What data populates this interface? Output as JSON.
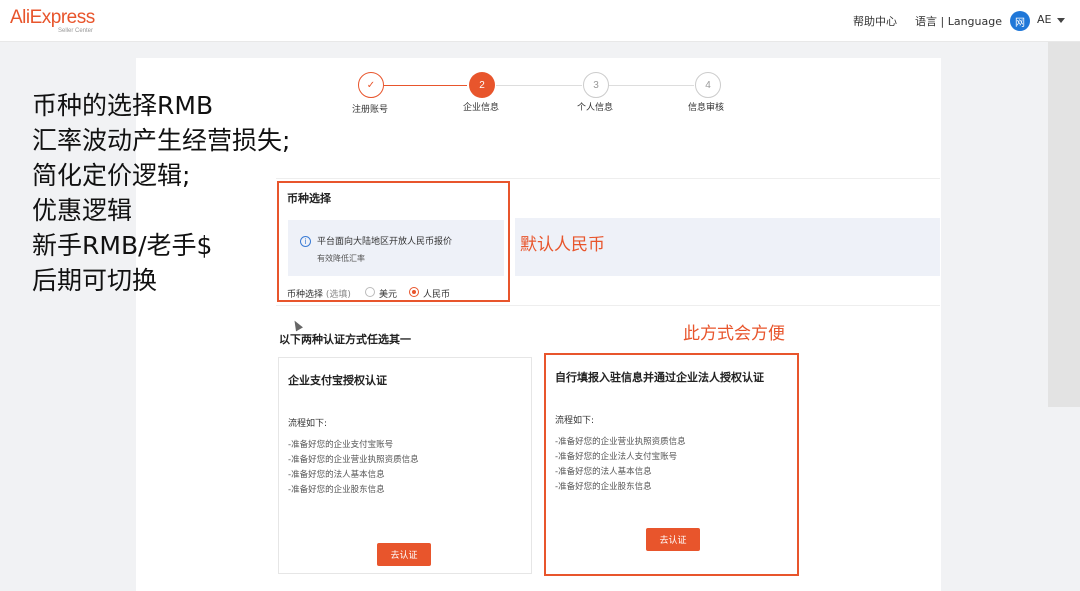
{
  "header": {
    "logo_main": "AliExpress",
    "logo_sub": "Seller Center",
    "help_link": "帮助中心",
    "language_link": "语言 | Language",
    "avatar_text": "网",
    "user_name": "AE"
  },
  "notes": {
    "lines": [
      "币种的选择RMB",
      "汇率波动产生经营损失;",
      "简化定价逻辑;",
      "优惠逻辑",
      "新手RMB/老手$",
      "后期可切换"
    ]
  },
  "steps": [
    {
      "number": "✓",
      "label": "注册账号",
      "state": "done"
    },
    {
      "number": "2",
      "label": "企业信息",
      "state": "active"
    },
    {
      "number": "3",
      "label": "个人信息",
      "state": "todo"
    },
    {
      "number": "4",
      "label": "信息审核",
      "state": "todo"
    }
  ],
  "currency": {
    "title": "币种选择",
    "notice_line1": "平台面向大陆地区开放人民币报价",
    "notice_line2": "有效降低汇率",
    "field_label": "币种选择",
    "field_hint": "(选填)",
    "options": [
      "美元",
      "人民币"
    ],
    "selected": "人民币"
  },
  "annotations": {
    "default_rmb": "默认人民币",
    "convenient": "此方式会方便"
  },
  "auth": {
    "section_title": "以下两种认证方式任选其一",
    "cards": [
      {
        "title": "企业支付宝授权认证",
        "flow_label": "流程如下:",
        "items": [
          "-准备好您的企业支付宝账号",
          "-准备好您的企业营业执照资质信息",
          "-准备好您的法人基本信息",
          "-准备好您的企业股东信息"
        ],
        "button": "去认证"
      },
      {
        "title": "自行填报入驻信息并通过企业法人授权认证",
        "flow_label": "流程如下:",
        "items": [
          "-准备好您的企业营业执照资质信息",
          "-准备好您的企业法人支付宝账号",
          "-准备好您的法人基本信息",
          "-准备好您的企业股东信息"
        ],
        "button": "去认证"
      }
    ]
  },
  "colors": {
    "brand": "#e8552c",
    "info": "#3a7bd5",
    "avatar": "#1f77d8"
  }
}
